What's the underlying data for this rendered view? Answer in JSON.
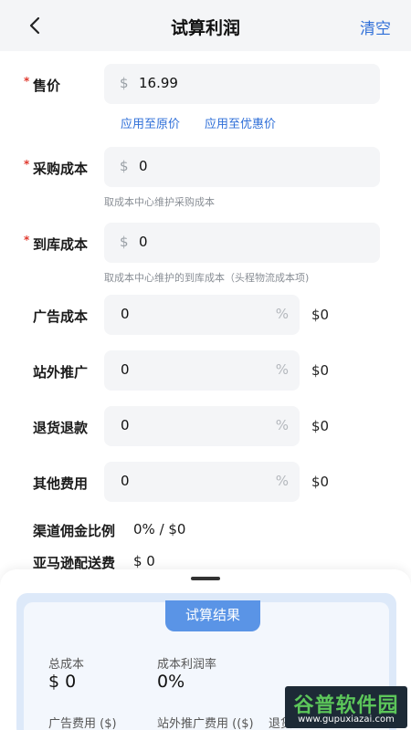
{
  "header": {
    "title": "试算利润",
    "clear_label": "清空"
  },
  "currency_symbol": "$",
  "required_mark": "*",
  "percent_symbol": "%",
  "sale_price": {
    "label": "售价",
    "value": "16.99",
    "links": [
      "应用至原价",
      "应用至优惠价"
    ]
  },
  "purchase_cost": {
    "label": "采购成本",
    "value": "0",
    "hint": "取成本中心维护采购成本"
  },
  "warehouse_cost": {
    "label": "到库成本",
    "value": "0",
    "hint": "取成本中心维护的到库成本（头程物流成本项)"
  },
  "percent_rows": [
    {
      "label": "广告成本",
      "value": "0",
      "amount": "$0"
    },
    {
      "label": "站外推广",
      "value": "0",
      "amount": "$0"
    },
    {
      "label": "退货退款",
      "value": "0",
      "amount": "$0"
    },
    {
      "label": "其他费用",
      "value": "0",
      "amount": "$0"
    }
  ],
  "channel_commission": {
    "label": "渠道佣金比例",
    "value": "0% / $0"
  },
  "amazon_fee": {
    "label": "亚马逊配送费",
    "value": "$ 0"
  },
  "result": {
    "tab_label": "试算结果",
    "total_cost_label": "总成本",
    "total_cost_value": "$ 0",
    "margin_label": "成本利润率",
    "margin_value": "0%",
    "ad_fee_label": "广告费用 ($)",
    "promo_fee_label": "站外推广费用 (($)",
    "refund_label": "退货"
  },
  "watermark": {
    "title": "谷普软件园",
    "url": "www.gupuxiazai.com"
  },
  "colors": {
    "accent": "#2f6fd8",
    "required": "#e0392e",
    "field_bg": "#f4f5f7",
    "result_tab": "#5a94e6"
  }
}
